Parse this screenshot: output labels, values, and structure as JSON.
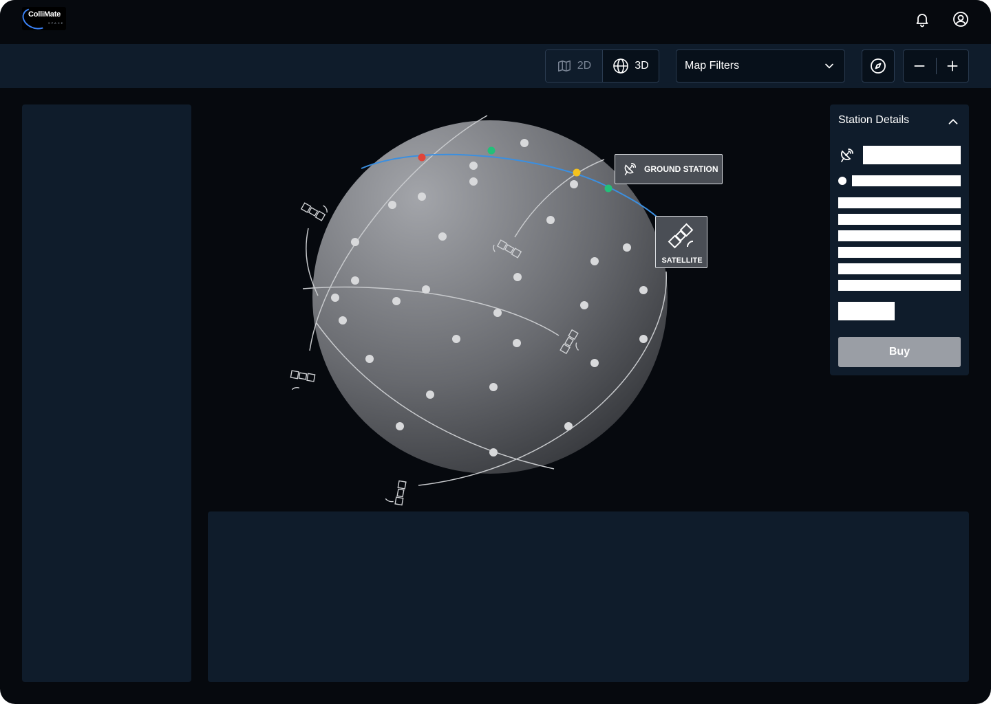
{
  "header": {
    "logo": {
      "name": "ColliMate",
      "sub": "SPACE"
    },
    "icons": [
      "bell-icon",
      "user-circle-icon"
    ]
  },
  "toolbar": {
    "view_2d": "2D",
    "view_3d": "3D",
    "active_view": "3D",
    "filters_label": "Map Filters"
  },
  "map": {
    "ground_station_label": "GROUND STATION",
    "satellite_label": "SATELLITE",
    "highlight_colors": {
      "orbit": "#3b8fe0",
      "red": "#e0453a",
      "green": "#22c07a",
      "yellow": "#f4c21e"
    }
  },
  "station_details": {
    "title": "Station Details",
    "buy_label": "Buy"
  },
  "colors": {
    "background": "#06090e",
    "panel": "#0f1c2b",
    "border": "#2a3b50"
  }
}
